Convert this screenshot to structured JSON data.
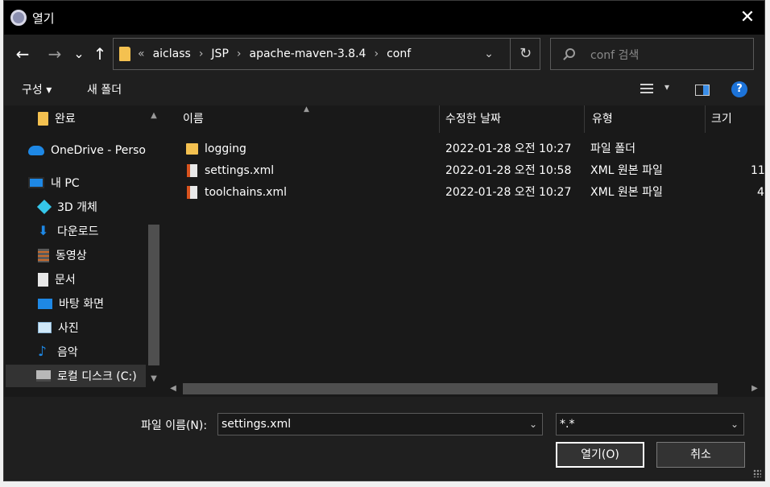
{
  "window": {
    "title": "열기",
    "close_glyph": "✕"
  },
  "nav": {
    "back": "←",
    "forward": "→",
    "recent": "⌄",
    "up": "↑"
  },
  "address": {
    "overflow": "«",
    "crumbs": [
      "aiclass",
      "JSP",
      "apache-maven-3.8.4",
      "conf"
    ],
    "separator": "›",
    "dropdown": "⌄",
    "refresh": "↻"
  },
  "search": {
    "placeholder": "conf 검색"
  },
  "toolbar": {
    "organize": "구성 ▾",
    "new_folder": "새 폴더",
    "help": "?",
    "view_caret": "▾"
  },
  "sidebar": {
    "items": [
      {
        "label": "완료",
        "icon": "folder-icon"
      },
      {
        "label": "OneDrive - Personal",
        "icon": "onedrive-icon"
      },
      {
        "label": "내 PC",
        "icon": "pc-icon"
      },
      {
        "label": "3D 개체",
        "icon": "3d-objects-icon"
      },
      {
        "label": "다운로드",
        "icon": "download-icon"
      },
      {
        "label": "동영상",
        "icon": "video-icon"
      },
      {
        "label": "문서",
        "icon": "document-icon"
      },
      {
        "label": "바탕 화면",
        "icon": "desktop-icon"
      },
      {
        "label": "사진",
        "icon": "pictures-icon"
      },
      {
        "label": "음악",
        "icon": "music-icon"
      },
      {
        "label": "로컬 디스크 (C:)",
        "icon": "drive-icon"
      }
    ]
  },
  "files": {
    "columns": [
      "이름",
      "수정한 날짜",
      "유형",
      "크기"
    ],
    "rows": [
      {
        "name": "logging",
        "date": "2022-01-28 오전 10:27",
        "type": "파일 폴더",
        "size": "",
        "icon": "folder-icon"
      },
      {
        "name": "settings.xml",
        "date": "2022-01-28 오전 10:58",
        "type": "XML 원본 파일",
        "size": "11",
        "icon": "xml-file-icon"
      },
      {
        "name": "toolchains.xml",
        "date": "2022-01-28 오전 10:27",
        "type": "XML 원본 파일",
        "size": "4",
        "icon": "xml-file-icon"
      }
    ]
  },
  "footer": {
    "filename_label": "파일 이름(N):",
    "filename_value": "settings.xml",
    "filter_value": "*.*",
    "open_label": "열기(O)",
    "cancel_label": "취소"
  },
  "colors": {
    "accent": "#1e88e5",
    "folder": "#f4c150",
    "background": "#191919"
  }
}
